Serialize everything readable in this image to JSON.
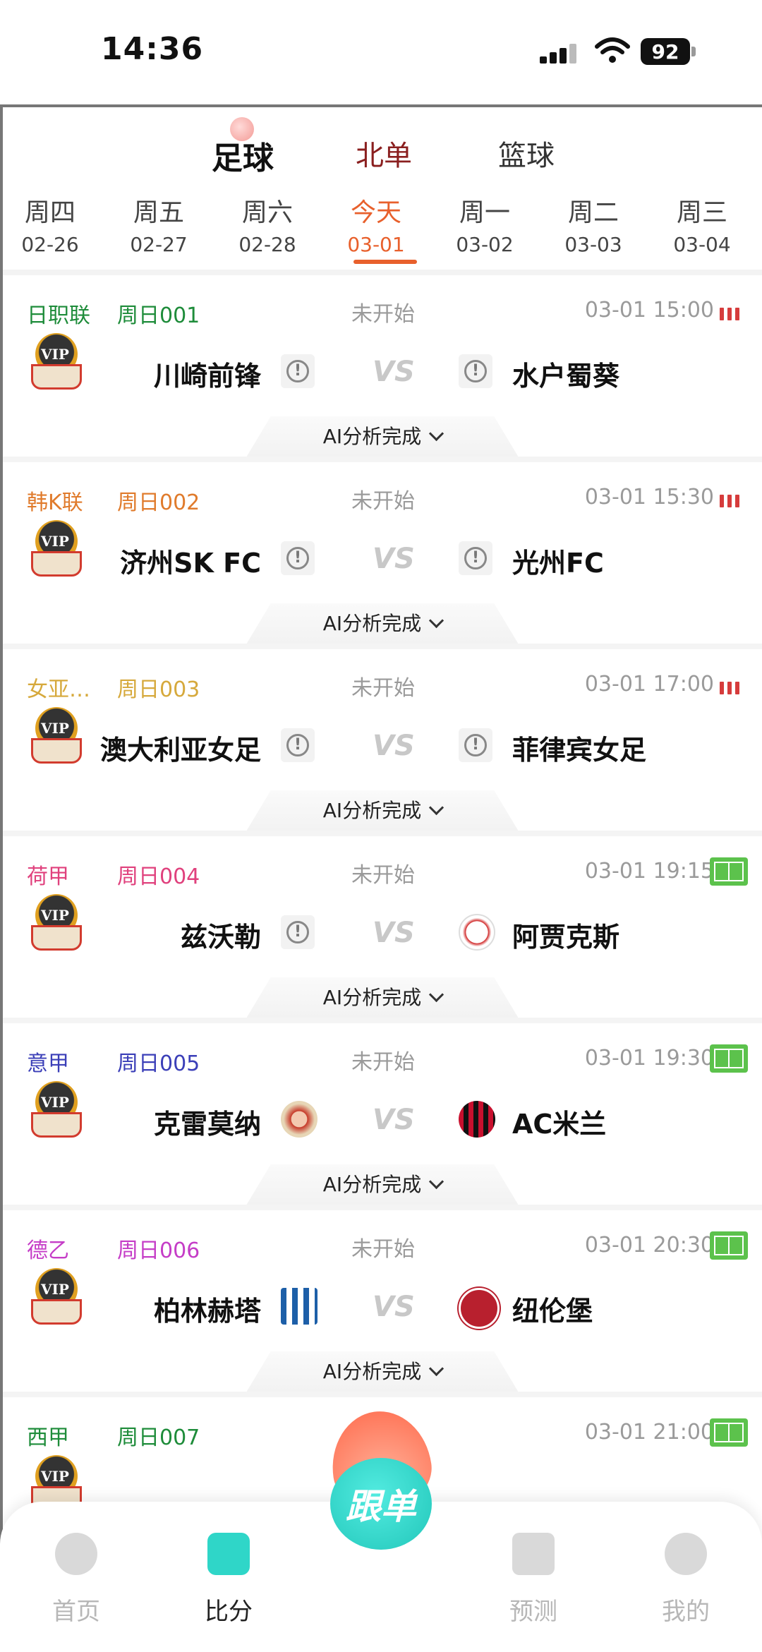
{
  "status_bar": {
    "time": "14:36",
    "battery": "92"
  },
  "sport_tabs": [
    {
      "label": "足球",
      "active": true
    },
    {
      "label": "北单",
      "active": false
    },
    {
      "label": "篮球",
      "active": false
    }
  ],
  "days": [
    {
      "weekday": "周四",
      "date": "02-26"
    },
    {
      "weekday": "周五",
      "date": "02-27"
    },
    {
      "weekday": "周六",
      "date": "02-28"
    },
    {
      "weekday": "今天",
      "date": "03-01"
    },
    {
      "weekday": "周一",
      "date": "03-02"
    },
    {
      "weekday": "周二",
      "date": "03-03"
    },
    {
      "weekday": "周三",
      "date": "03-04"
    }
  ],
  "vs_label": "VS",
  "vip_label": "VIP",
  "ai_label": "AI分析完成",
  "matches": [
    {
      "league": "日职联",
      "code": "周日001",
      "status": "未开始",
      "time": "03-01 15:00",
      "home": "川崎前锋",
      "away": "水户蜀葵",
      "color": "#1e8c3a",
      "indicator": "bars"
    },
    {
      "league": "韩K联",
      "code": "周日002",
      "status": "未开始",
      "time": "03-01 15:30",
      "home": "济州SK FC",
      "away": "光州FC",
      "color": "#e07b2c",
      "indicator": "bars"
    },
    {
      "league": "女亚…",
      "code": "周日003",
      "status": "未开始",
      "time": "03-01 17:00",
      "home": "澳大利亚女足",
      "away": "菲律宾女足",
      "color": "#d6a93c",
      "indicator": "bars"
    },
    {
      "league": "荷甲",
      "code": "周日004",
      "status": "未开始",
      "time": "03-01 19:15",
      "home": "兹沃勒",
      "away": "阿贾克斯",
      "color": "#e0417d",
      "indicator": "pitch"
    },
    {
      "league": "意甲",
      "code": "周日005",
      "status": "未开始",
      "time": "03-01 19:30",
      "home": "克雷莫纳",
      "away": "AC米兰",
      "color": "#3b3fb8",
      "indicator": "pitch"
    },
    {
      "league": "德乙",
      "code": "周日006",
      "status": "未开始",
      "time": "03-01 20:30",
      "home": "柏林赫塔",
      "away": "纽伦堡",
      "color": "#c53dc7",
      "indicator": "pitch"
    },
    {
      "league": "西甲",
      "code": "周日007",
      "status": "未开始",
      "time": "03-01 21:00",
      "home": "",
      "away": "",
      "color": "#1e8c3a",
      "indicator": "pitch"
    }
  ],
  "bottom_nav": {
    "items": [
      {
        "label": "首页",
        "icon": "soccer-ball-icon"
      },
      {
        "label": "比分",
        "icon": "score-bag-icon",
        "active": true
      },
      {
        "label": "预测",
        "icon": "ai-chat-icon"
      },
      {
        "label": "我的",
        "icon": "profile-icon"
      }
    ],
    "follow_label": "跟单"
  },
  "colors": {
    "accent": "#e8602c",
    "teal": "#2fd6c8",
    "live_green": "#5cc24c",
    "bars_red": "#d63c3c"
  }
}
